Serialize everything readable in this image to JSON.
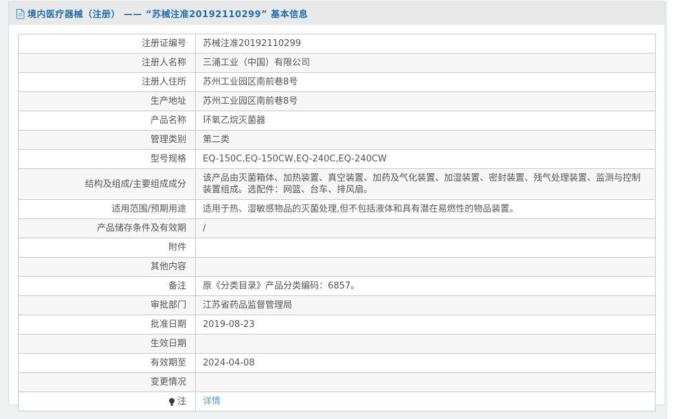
{
  "header": {
    "title": "境内医疗器械（注册） ——  “苏械注准20192110299” 基本信息"
  },
  "table": {
    "rows": [
      {
        "label": "注册证编号",
        "value": "苏械注准20192110299"
      },
      {
        "label": "注册人名称",
        "value": "三浦工业（中国）有限公司"
      },
      {
        "label": "注册人住所",
        "value": "苏州工业园区南前巷8号"
      },
      {
        "label": "生产地址",
        "value": "苏州工业园区南前巷8号"
      },
      {
        "label": "产品名称",
        "value": "环氧乙烷灭菌器"
      },
      {
        "label": "管理类别",
        "value": "第二类"
      },
      {
        "label": "型号规格",
        "value": "EQ-150C,EQ-150CW,EQ-240C,EQ-240CW"
      },
      {
        "label": "结构及组成/主要组成成分",
        "value": "该产品由灭菌箱体、加热装置、真空装置、加药及气化装置、加湿装置、密封装置、残气处理装置、监测与控制装置组成。选配件：网篮、台车、排风扇。"
      },
      {
        "label": "适用范围/预期用途",
        "value": "适用于热、湿敏感物品的灭菌处理,但不包括液体和具有潜在易燃性的物品装置。"
      },
      {
        "label": "产品储存条件及有效期",
        "value": "/"
      },
      {
        "label": "附件",
        "value": ""
      },
      {
        "label": "其他内容",
        "value": ""
      },
      {
        "label": "备注",
        "value": "原《分类目录》产品分类编码：6857。"
      },
      {
        "label": "审批部门",
        "value": "江苏省药品监督管理局"
      },
      {
        "label": "批准日期",
        "value": "2019-08-23"
      },
      {
        "label": "生效日期",
        "value": ""
      },
      {
        "label": "有效期至",
        "value": "2024-04-08"
      },
      {
        "label": "变更情况",
        "value": ""
      }
    ],
    "note_row": {
      "label": "注",
      "link_text": "详情"
    }
  },
  "colors": {
    "title_blue": "#2170ac",
    "link_blue": "#5e97d0",
    "header_bar_bg": "#e9e9e9",
    "row_alt_bg": "#f7f7f7",
    "table_border": "#c9c9c9",
    "page_bg": "#eff2f3"
  }
}
